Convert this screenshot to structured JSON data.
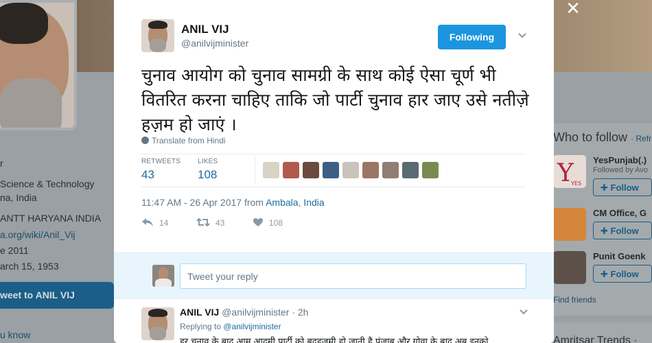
{
  "background": {
    "profile_left_lines": {
      "l1": "r",
      "l2": "Science & Technology",
      "l3": "na, India",
      "l4": "ANTT HARYANA INDIA",
      "l5": "a.org/wiki/Anil_Vij",
      "l6": "e 2011",
      "l7": "arch 15, 1953"
    },
    "tweet_to_button": "weet to ANIL VIJ",
    "people_you_know": "u know",
    "who_to_follow": {
      "title": "Who to follow",
      "refresh": "· Refr",
      "items": [
        {
          "name": "YesPunjab(.)",
          "sub": "Followed by Avo",
          "follow_label": "Follow"
        },
        {
          "name": "CM Office, G",
          "sub": "",
          "follow_label": "Follow"
        },
        {
          "name": "Punit Goenk",
          "sub": "",
          "follow_label": "Follow"
        }
      ],
      "find_friends": "Find friends"
    },
    "trends_title": "Amritsar Trends ·"
  },
  "modal": {
    "close_label": "✕",
    "author": {
      "name": "ANIL VIJ",
      "handle": "@anilvijminister"
    },
    "follow_button": "Following",
    "tweet_text": "चुनाव आयोग को चुनाव सामग्री के साथ कोई ऐसा चूर्ण भी वितरित करना चाहिए ताकि जो पार्टी चुनाव हार जाए उसे नतीज़े हज़म हो जाएं ।",
    "translate": "Translate from Hindi",
    "stats": {
      "retweets_label": "RETWEETS",
      "retweets": "43",
      "likes_label": "LIKES",
      "likes": "108"
    },
    "liker_colors": [
      "#d9d3c6",
      "#b05a4c",
      "#6b4b3f",
      "#3d5f86",
      "#c9c3bb",
      "#9a7664",
      "#8f7e74",
      "#5a6a72",
      "#7a8a4e"
    ],
    "timestamp": "11:47 AM - 26 Apr 2017 from",
    "location_city": "Ambala",
    "location_country": "India",
    "actions": {
      "reply": "14",
      "retweet": "43",
      "like": "108"
    },
    "reply_placeholder": "Tweet your reply",
    "reply_tweet": {
      "name": "ANIL VIJ",
      "handle": "@anilvijminister",
      "time": "· 2h",
      "replying_prefix": "Replying to",
      "replying_to": "@anilvijminister",
      "text": "हर चुनाव के बाद आम आदमी पार्टी को बदहज़मी हो जाती है पंजाब और गोवा के बाद अब इनको"
    }
  }
}
